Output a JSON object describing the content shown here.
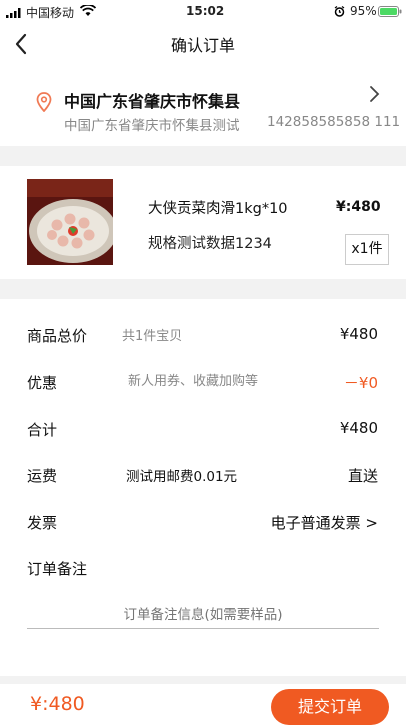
{
  "status": {
    "carrier": "中国移动",
    "time": "15:02",
    "battery": "95%"
  },
  "nav": {
    "title": "确认订单"
  },
  "address": {
    "region": "中国广东省肇庆市怀集县",
    "detail": "中国广东省肇庆市怀集县测试",
    "phone": "142858585858 111"
  },
  "product": {
    "name": "大侠贡菜肉滑1kg*10",
    "spec": "规格测试数据1234",
    "price": "¥:480",
    "quantity": "x1件"
  },
  "summary": {
    "total_label": "商品总价",
    "total_hint": "共1件宝贝",
    "total_value": "¥480",
    "discount_label": "优惠",
    "discount_hint": "新人用券、收藏加购等",
    "discount_value": "－¥0",
    "sum_label": "合计",
    "sum_value": "¥480",
    "shipping_label": "运费",
    "shipping_hint": "测试用邮费0.01元",
    "shipping_value": "直送",
    "invoice_label": "发票",
    "invoice_value": "电子普通发票 >",
    "note_label": "订单备注",
    "note_placeholder": "订单备注信息(如需要样品)"
  },
  "footer": {
    "amount": "¥:480",
    "submit_label": "提交订单"
  },
  "colors": {
    "accent": "#f05a22",
    "location_icon": "#f07a55"
  }
}
